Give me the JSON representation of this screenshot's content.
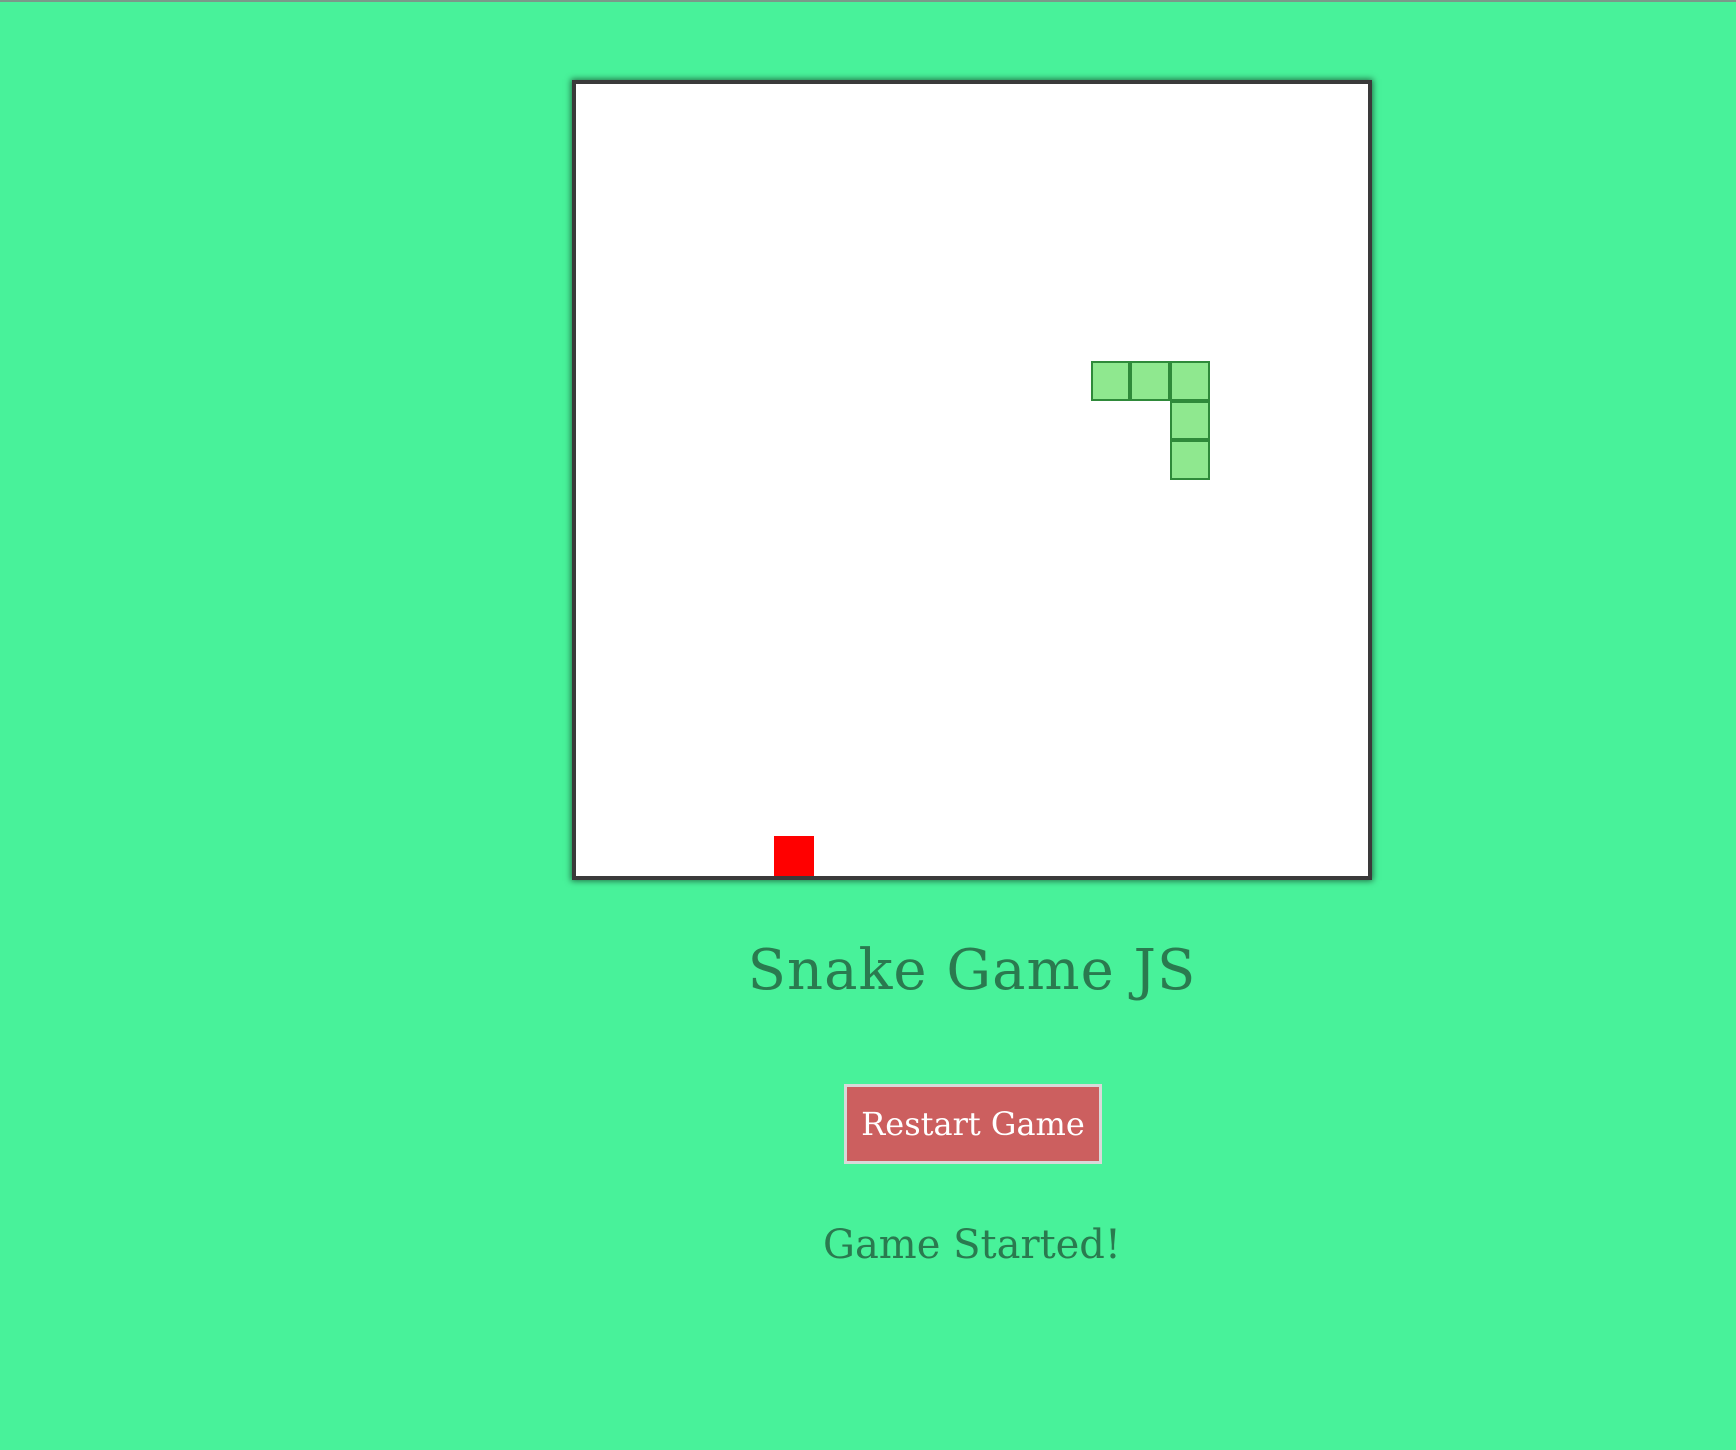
{
  "game": {
    "title": "Snake Game JS",
    "restart_label": "Restart Game",
    "status": "Game Started!",
    "grid": {
      "cols": 20,
      "rows": 20
    },
    "snake": [
      {
        "col": 13,
        "row": 7
      },
      {
        "col": 14,
        "row": 7
      },
      {
        "col": 15,
        "row": 7
      },
      {
        "col": 15,
        "row": 8
      },
      {
        "col": 15,
        "row": 9
      }
    ],
    "food": {
      "col": 5,
      "row": 19
    },
    "colors": {
      "background": "#48f29a",
      "board": "#ffffff",
      "snake_fill": "#8fe88f",
      "snake_border": "#2f8a3a",
      "food": "#ff0000",
      "text": "#2a7a4f",
      "button": "#cc5f5f"
    }
  }
}
